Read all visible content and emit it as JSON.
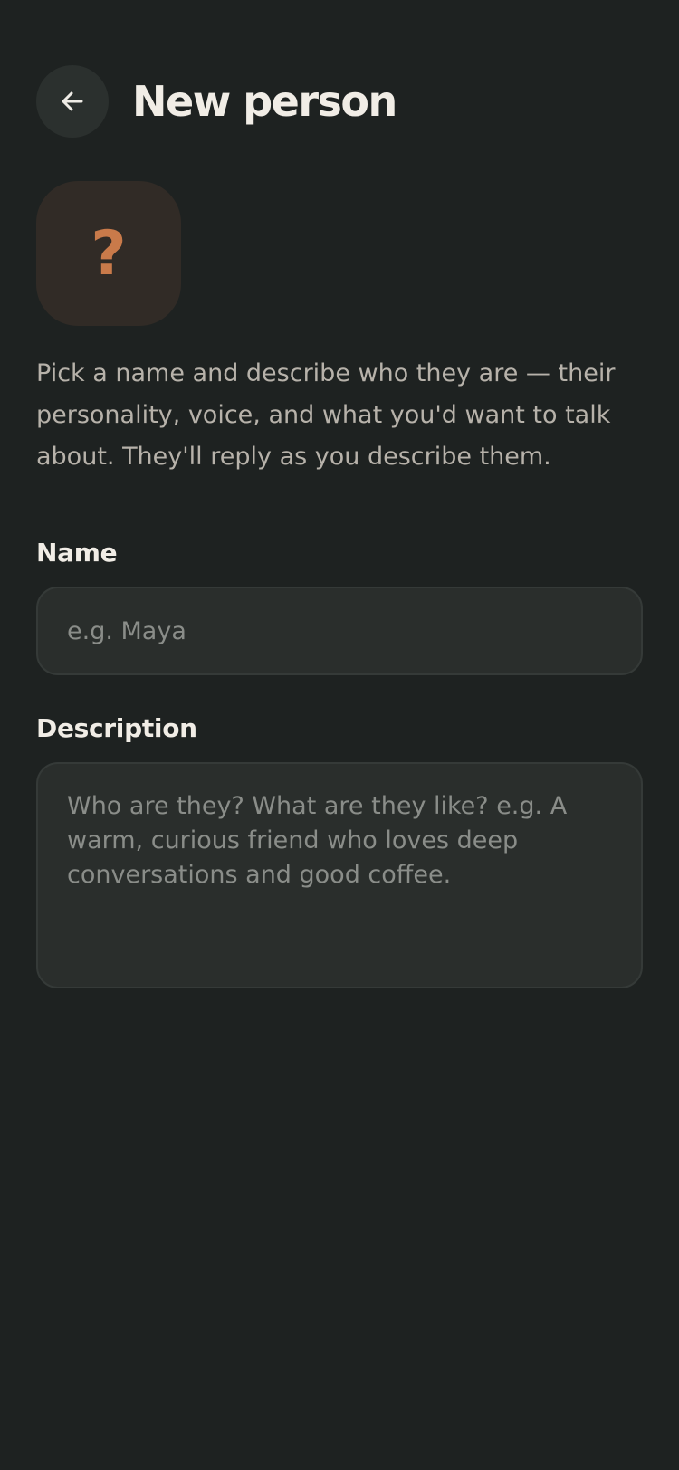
{
  "header": {
    "back_icon": "arrow-left-icon",
    "title": "New person"
  },
  "avatar": {
    "glyph": "?",
    "glyph_color": "#c97a4a",
    "background": "#312b26"
  },
  "intro_text": "Pick a name and describe who they are — their personality, voice, and what you'd want to talk about. They'll reply as you describe them.",
  "form": {
    "name": {
      "label": "Name",
      "value": "",
      "placeholder": "e.g. Maya"
    },
    "description": {
      "label": "Description",
      "value": "",
      "placeholder": "Who are they? What are they like? e.g. A warm, curious friend who loves deep conversations and good coffee."
    }
  },
  "colors": {
    "background": "#1e2221",
    "surface": "#2a2e2c",
    "text": "#efece6",
    "muted_text": "#b7b2aa",
    "accent": "#c97a4a"
  }
}
